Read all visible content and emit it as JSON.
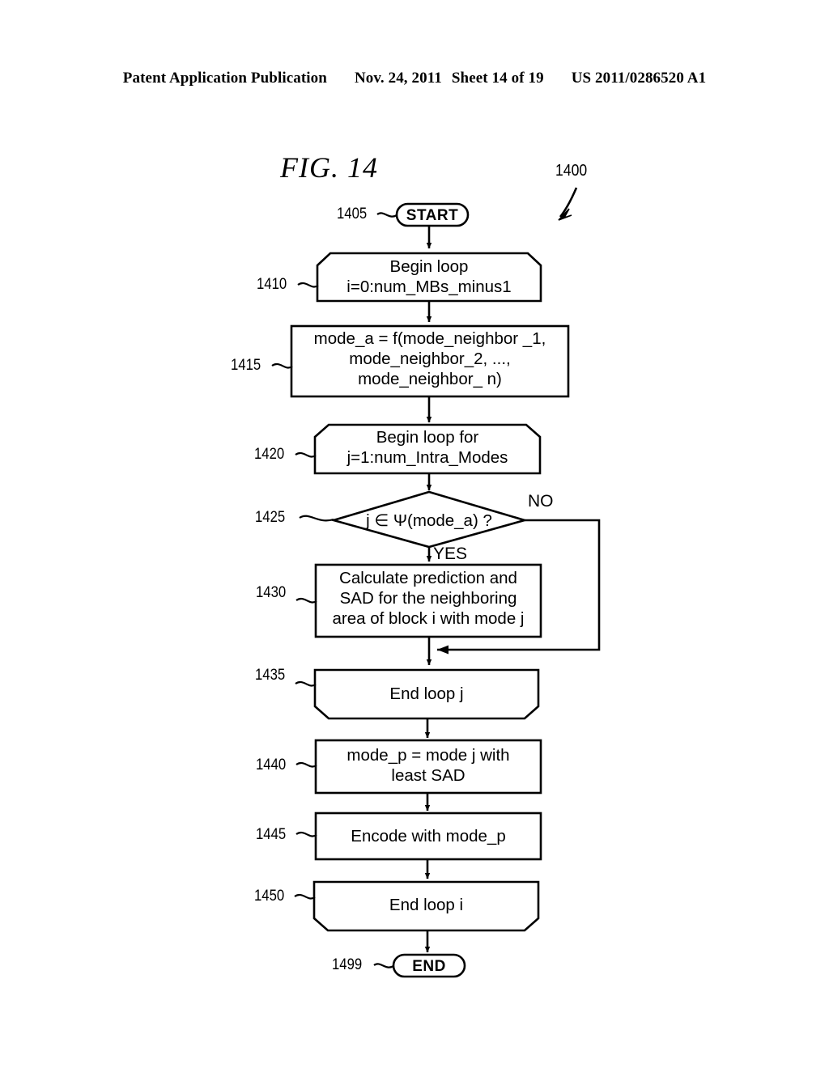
{
  "header": {
    "publication": "Patent Application Publication",
    "date": "Nov. 24, 2011",
    "sheet": "Sheet 14 of 19",
    "patent_number": "US 2011/0286520 A1"
  },
  "figure": {
    "label": "FIG. 14",
    "diagram_ref": "1400"
  },
  "flowchart": {
    "nodes": [
      {
        "ref": "1405",
        "shape": "terminator",
        "text": "START"
      },
      {
        "ref": "1410",
        "shape": "loop-begin",
        "text": "Begin loop\ni=0:num_MBs_minus1"
      },
      {
        "ref": "1415",
        "shape": "process",
        "text": "mode_a = f(mode_neighbor _1,\nmode_neighbor_2, ...,\nmode_neighbor_ n)"
      },
      {
        "ref": "1420",
        "shape": "loop-begin",
        "text": "Begin loop for\nj=1:num_Intra_Modes"
      },
      {
        "ref": "1425",
        "shape": "decision",
        "text": "j ∈ Ψ(mode_a) ?"
      },
      {
        "ref": "1430",
        "shape": "process",
        "text": "Calculate prediction and\nSAD for the neighboring\narea of block i with mode j"
      },
      {
        "ref": "1435",
        "shape": "loop-end",
        "text": "End loop j"
      },
      {
        "ref": "1440",
        "shape": "process",
        "text": "mode_p = mode j with\nleast SAD"
      },
      {
        "ref": "1445",
        "shape": "process",
        "text": "Encode with mode_p"
      },
      {
        "ref": "1450",
        "shape": "loop-end",
        "text": "End loop i"
      },
      {
        "ref": "1499",
        "shape": "terminator",
        "text": "END"
      }
    ],
    "branch_labels": {
      "yes": "YES",
      "no": "NO"
    }
  },
  "colors": {
    "ink": "#000000",
    "paper": "#ffffff"
  }
}
